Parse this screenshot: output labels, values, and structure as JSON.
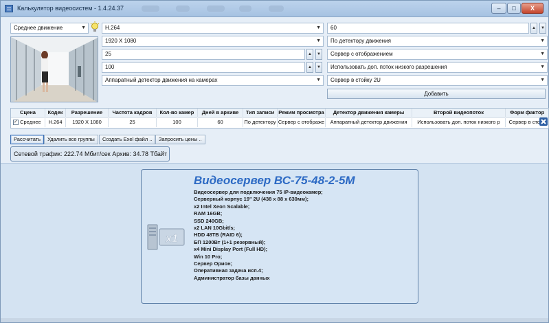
{
  "window": {
    "title": "Калькулятор видеосистем - 1.4.24.37",
    "minimize": "–",
    "maximize": "□",
    "close": "X"
  },
  "left": {
    "scene_select": "Среднее движение"
  },
  "middle": {
    "codec": "H.264",
    "resolution": "1920 X 1080",
    "fps": "25",
    "cameras": "100",
    "motion_detector": "Аппаратный детектор движения на камерах"
  },
  "right": {
    "archive_days": "60",
    "record_type": "По детектору движения",
    "view_mode": "Сервер с отображением",
    "second_stream": "Использовать доп. поток низкого разрешения",
    "form_factor": "Сервер в стойку 2U",
    "add_button": "Добавить"
  },
  "table": {
    "columns": [
      "Сцена",
      "Кодек",
      "Разрешение",
      "Частота кадров",
      "Кол-во камер",
      "Дней в архиве",
      "Тип записи",
      "Режим просмотра",
      "Детектор движения камеры",
      "Второй видеопоток",
      "Форм фактор"
    ],
    "rows": [
      [
        "Среднее",
        "H.264",
        "1920 X 1080",
        "25",
        "100",
        "60",
        "По детектору",
        "Сервер с отображе",
        "Аппаратный детектор движения",
        "Использовать доп. поток низкого р",
        "Сервер в стойк"
      ]
    ]
  },
  "actions": {
    "calculate": "Рассчитать",
    "delete_all": "Удалить все группы",
    "create_excel": "Создать Exel файл ..",
    "request_prices": "Запросить цены .."
  },
  "summary": {
    "text": "Сетевой трафик: 222.74 Мбит/сек   Архив: 34.78 Тбайт"
  },
  "server_card": {
    "title": "Видеосервер ВС-75-48-2-5М",
    "icon_label": "x1",
    "specs": [
      "Видеосервер для подключения 75 IP-видеокамер;",
      "Серверный корпус 19\" 2U (438 x 88 x 630мм);",
      "x2 Intel Xeon Scalable;",
      "RAM 16GB;",
      "SSD 240GB;",
      "x2 LAN 10Gbit/s;",
      "HDD 48TB (RAID 6);",
      "БП 1200Вт (1+1 резервный);",
      "x4 Mini Display Port (Full HD);",
      "Win 10 Pro;",
      "Сервер Орион;",
      "Оперативная задача исп.4;",
      "Администратор базы данных"
    ]
  },
  "colors": {
    "title_blue": "#2d6ac4",
    "panel_bg": "#d4e3f2",
    "border": "#5d7fa7"
  }
}
